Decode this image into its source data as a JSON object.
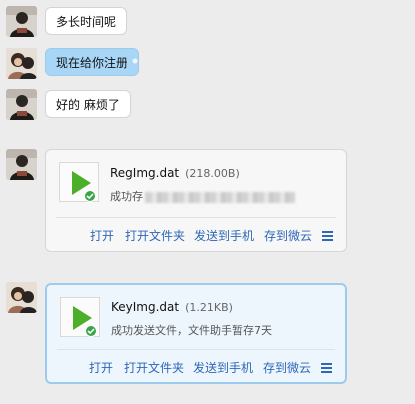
{
  "messages": [
    {
      "text": "多长时间呢"
    },
    {
      "text": "现在给你注册"
    },
    {
      "text": "好的 麻烦了"
    }
  ],
  "files": [
    {
      "name": "RegImg.dat",
      "size": "(218.00B)",
      "status": "成功存"
    },
    {
      "name": "KeyImg.dat",
      "size": "(1.21KB)",
      "status": "成功发送文件，文件助手暂存7天"
    }
  ],
  "actions": {
    "open": "打开",
    "open_folder": "打开文件夹",
    "send_phone": "发送到手机",
    "save_cloud": "存到微云"
  },
  "colors": {
    "bubble_out": "#a8d6f7",
    "link": "#2e67b8",
    "play_green": "#4caf2a",
    "check_green": "#3aa548"
  }
}
